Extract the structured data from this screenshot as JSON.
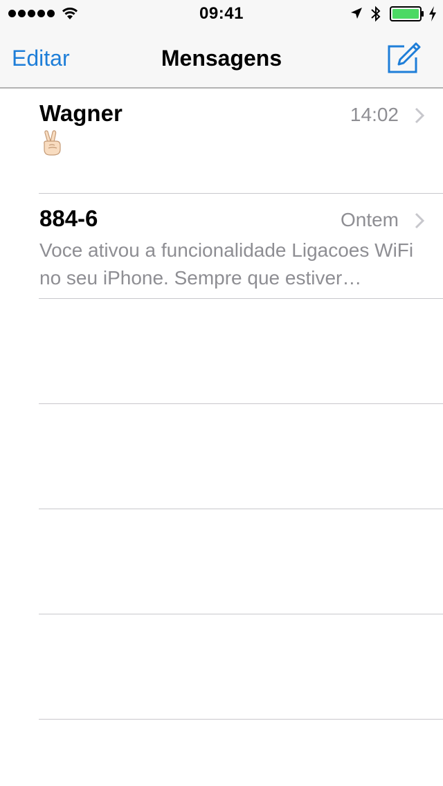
{
  "status_bar": {
    "signal_bars": 5,
    "wifi_icon": "wifi-icon",
    "time": "09:41",
    "location_icon": "location-arrow-icon",
    "bluetooth_icon": "bluetooth-icon",
    "battery_icon": "battery-icon",
    "battery_color": "#4cd964",
    "charging_icon": "charging-bolt-icon"
  },
  "nav": {
    "edit_label": "Editar",
    "title": "Mensagens",
    "compose_icon": "compose-icon",
    "accent_color": "#1e7ed8"
  },
  "conversations": [
    {
      "sender": "Wagner",
      "time": "14:02",
      "preview_emoji": "victory-hand-emoji"
    },
    {
      "sender": "884-6",
      "time": "Ontem",
      "preview": "Voce ativou a funcionalidade Ligacoes WiFi no seu iPhone. Sempre que estiver conectado a uma rede WiFi"
    }
  ]
}
